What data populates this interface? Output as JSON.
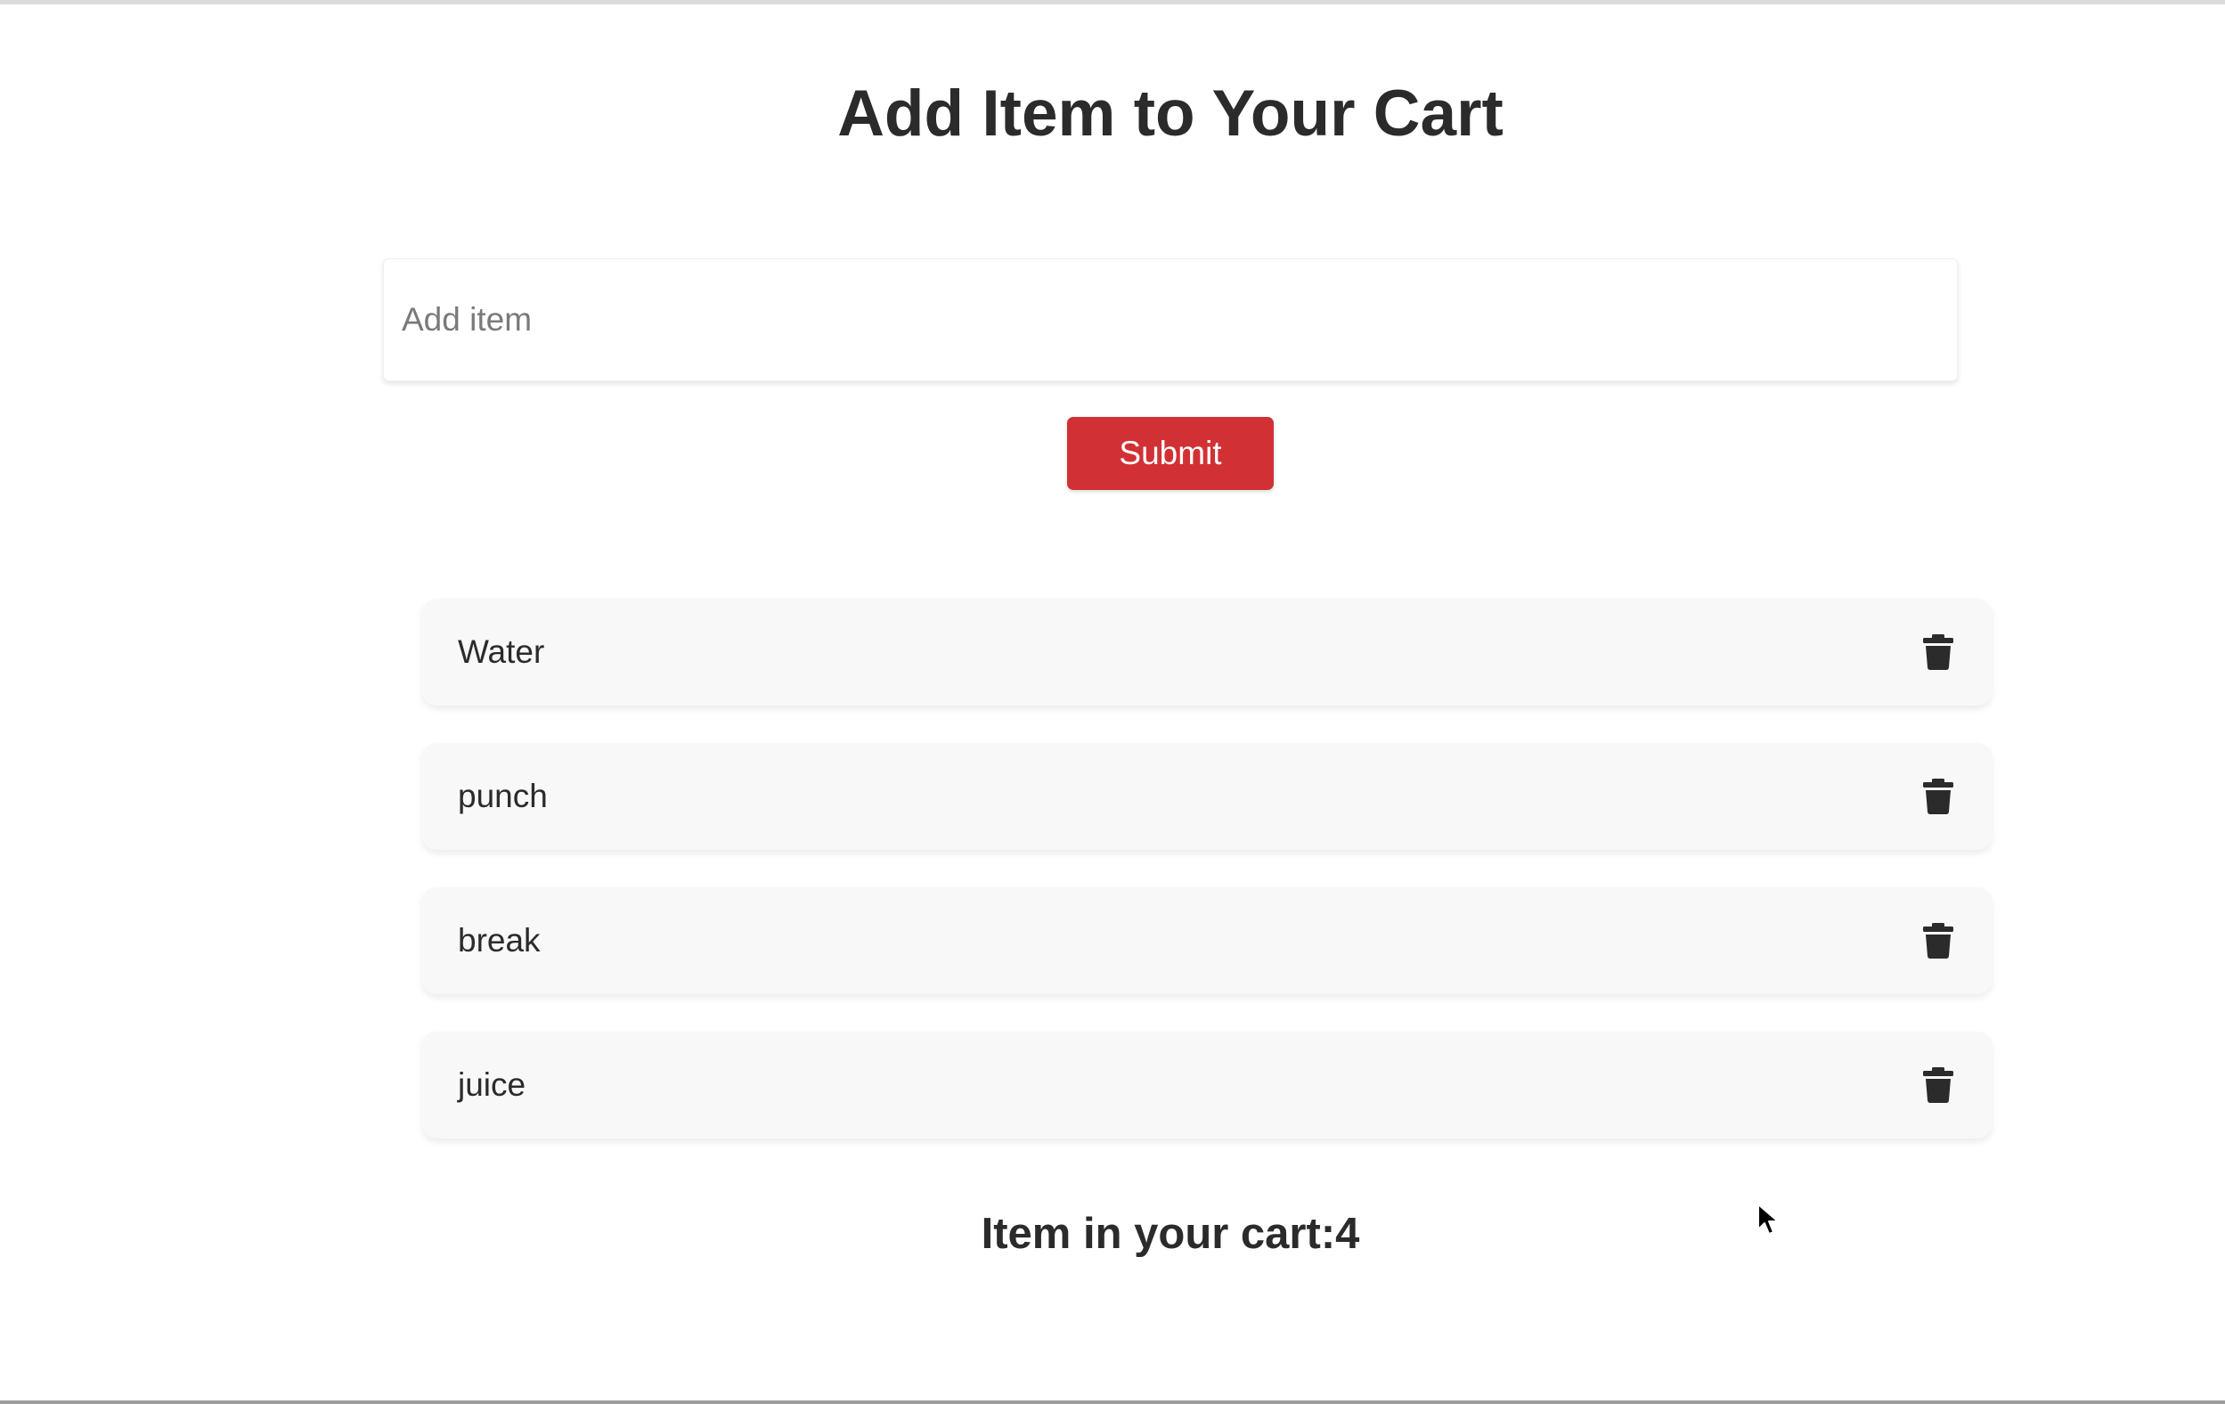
{
  "header": {
    "title": "Add Item to Your Cart"
  },
  "form": {
    "input_value": "",
    "input_placeholder": "Add item",
    "submit_label": "Submit"
  },
  "cart": {
    "items": [
      {
        "label": "Water",
        "icon": "trash-icon"
      },
      {
        "label": "punch",
        "icon": "trash-icon"
      },
      {
        "label": "break",
        "icon": "trash-icon"
      },
      {
        "label": "juice",
        "icon": "trash-icon"
      }
    ],
    "count_text": "Item in your cart:4"
  },
  "colors": {
    "submit_button": "#d13135",
    "title_text": "#2b2b2b",
    "item_background": "#f8f8f8"
  }
}
